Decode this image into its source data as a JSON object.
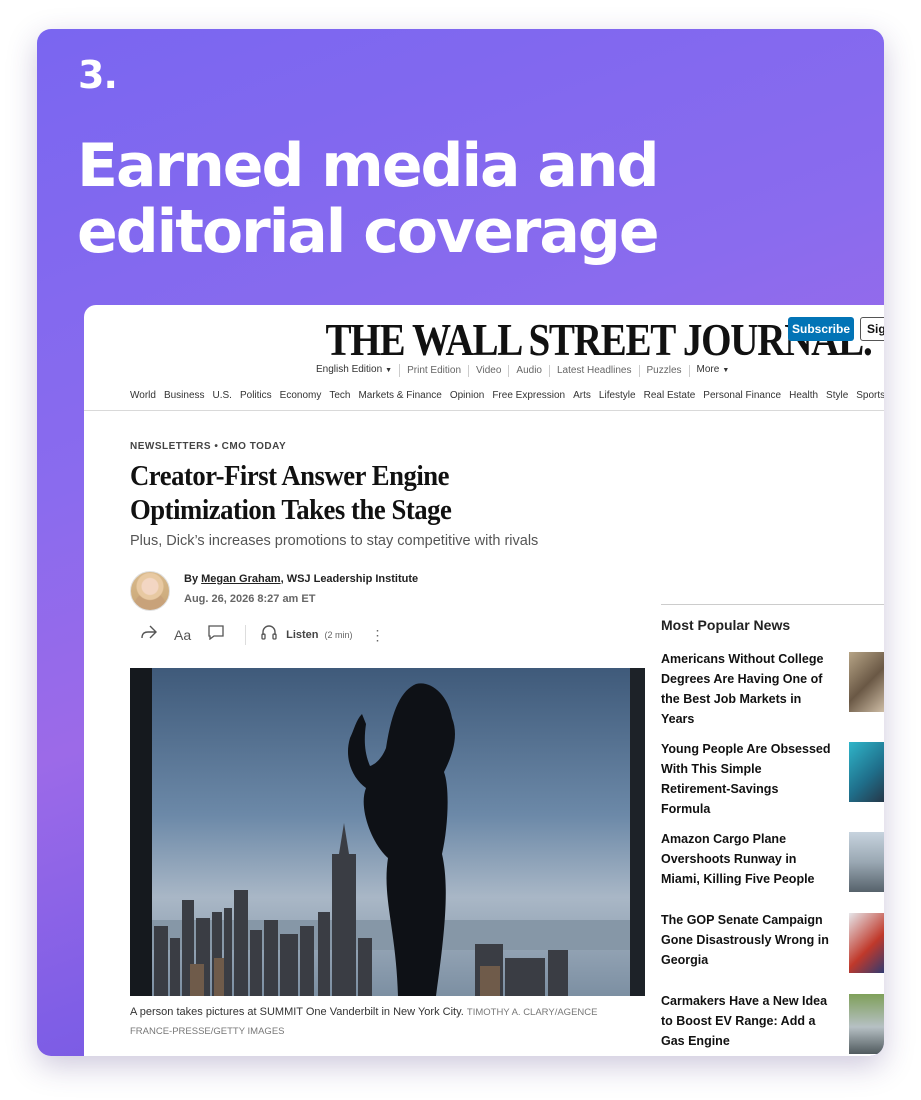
{
  "slide": {
    "number": "3.",
    "headline": "Earned media and editorial coverage"
  },
  "wsj": {
    "logo": "THE WALL STREET JOURNAL.",
    "subscribe_label": "Subscribe",
    "signin_label": "Sig",
    "subnav": [
      "English Edition",
      "Print Edition",
      "Video",
      "Audio",
      "Latest Headlines",
      "Puzzles",
      "More"
    ],
    "nav": [
      "World",
      "Business",
      "U.S.",
      "Politics",
      "Economy",
      "Tech",
      "Markets & Finance",
      "Opinion",
      "Free Expression",
      "Arts",
      "Lifestyle",
      "Real Estate",
      "Personal Finance",
      "Health",
      "Style",
      "Sports"
    ]
  },
  "article": {
    "kicker": "NEWSLETTERS • CMO TODAY",
    "title": "Creator-First Answer Engine Optimization Takes the Stage",
    "dek": "Plus, Dick’s increases promotions to stay competitive with rivals",
    "by_prefix": "By ",
    "author": "Megan Graham",
    "author_org": ", WSJ Leadership Institute",
    "date": "Aug. 26, 2026 8:27 am ET",
    "listen_label": "Listen",
    "listen_time": "(2 min)",
    "caption": "A person takes pictures at SUMMIT One Vanderbilt in New York City.",
    "credit": "TIMOTHY A. CLARY/AGENCE FRANCE-PRESSE/GETTY IMAGES"
  },
  "popular": {
    "title": "Most Popular News",
    "items": [
      "Americans Without College Degrees Are Having One of the Best Job Markets in Years",
      "Young People Are Obsessed With This Simple Retirement-Savings Formula",
      "Amazon Cargo Plane Overshoots Runway in Miami, Killing Five People",
      "The GOP Senate Campaign Gone Disastrously Wrong in Georgia",
      "Carmakers Have a New Idea to Boost EV Range: Add a Gas Engine"
    ]
  },
  "colors": {
    "card_gradient_start": "#7a66f0",
    "card_gradient_end": "#6a50d8",
    "subscribe_blue": "#0274b6"
  }
}
